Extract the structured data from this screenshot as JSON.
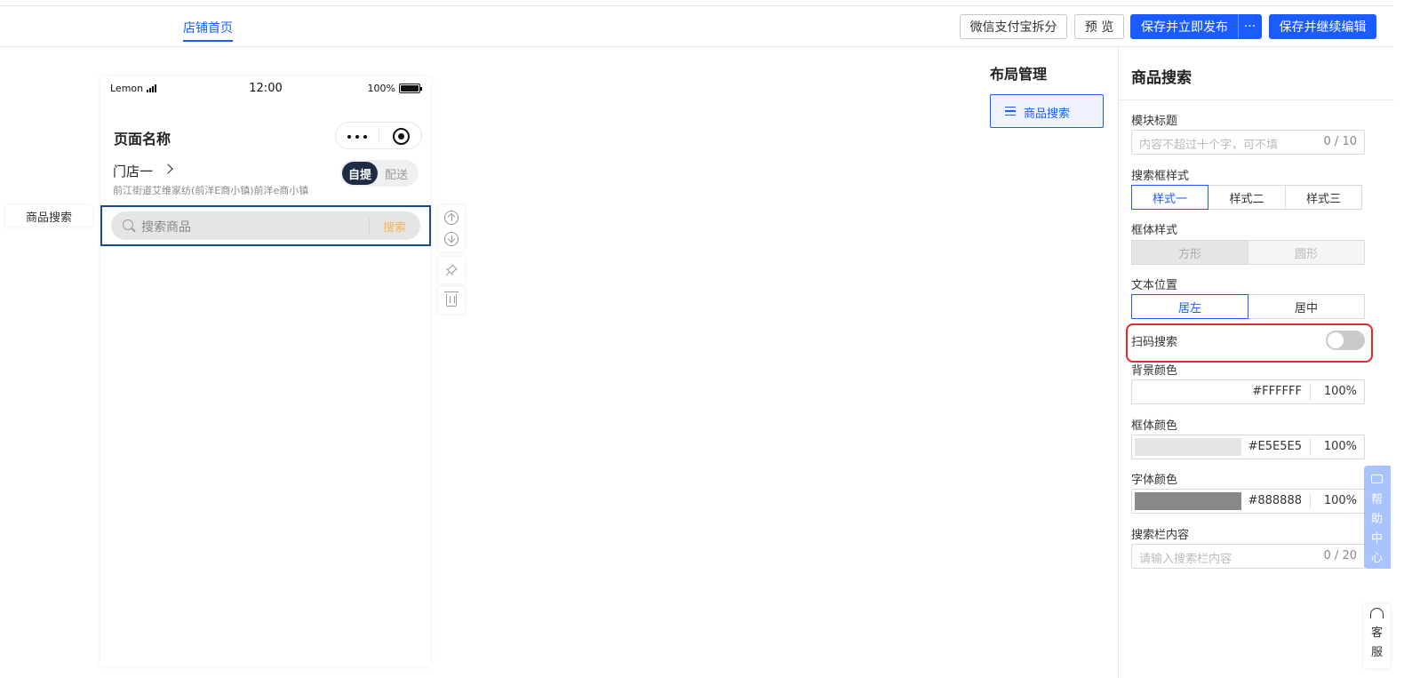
{
  "topbar": {
    "tab_home": "店铺首页",
    "btn_split": "微信支付宝拆分",
    "btn_preview": "预 览",
    "btn_save_publish": "保存并立即发布",
    "btn_more": "···",
    "btn_save_continue": "保存并继续编辑"
  },
  "phone": {
    "status": {
      "carrier": "Lemon",
      "time": "12:00",
      "battery": "100%"
    },
    "page_title": "页面名称",
    "store_name": "门店一",
    "store_address": "前江街道艾维家纺(前洋E商小镇)前洋e商小镇",
    "pickup_label": "自提",
    "delivery_label": "配送",
    "search_placeholder": "搜索商品",
    "search_button": "搜索"
  },
  "module_tag": "商品搜索",
  "layout": {
    "title": "布局管理",
    "item_label": "商品搜索"
  },
  "panel": {
    "title": "商品搜索",
    "module_title_label": "模块标题",
    "module_title_placeholder": "内容不超过十个字，可不填",
    "module_title_count": "0 / 10",
    "search_style_label": "搜索框样式",
    "search_styles": [
      "样式一",
      "样式二",
      "样式三"
    ],
    "frame_style_label": "框体样式",
    "frame_styles": [
      "方形",
      "圆形"
    ],
    "text_position_label": "文本位置",
    "text_positions": [
      "居左",
      "居中"
    ],
    "scan_label": "扫码搜索",
    "bg_color_label": "背景颜色",
    "bg_color": {
      "hex": "#FFFFFF",
      "pct": "100%"
    },
    "frame_color_label": "框体颜色",
    "frame_color": {
      "hex": "#E5E5E5",
      "pct": "100%"
    },
    "font_color_label": "字体颜色",
    "font_color": {
      "hex": "#888888",
      "pct": "100%"
    },
    "search_content_label": "搜索栏内容",
    "search_content_placeholder": "请输入搜索栏内容",
    "search_content_count": "0 / 20"
  },
  "floating": {
    "help_center": "帮助中心",
    "service": "客服"
  },
  "colors": {
    "accent": "#1a5cff",
    "selected_border": "#1a4a8f",
    "highlight_red": "#e5282a",
    "search_btn": "#f5b55a"
  }
}
